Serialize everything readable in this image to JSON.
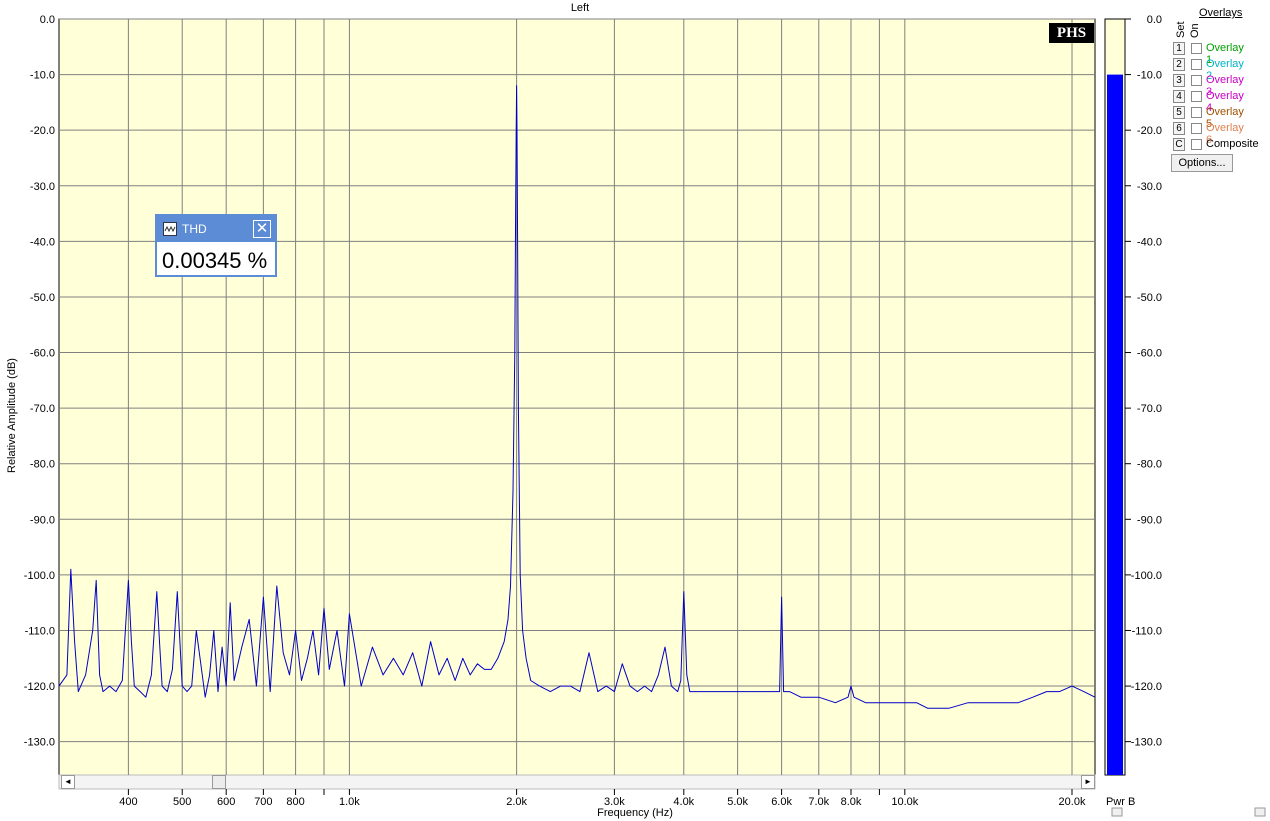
{
  "chart_data": {
    "type": "line",
    "title": "Left",
    "xlabel": "Frequency (Hz)",
    "ylabel": "Relative Amplitude (dB)",
    "xscale": "log",
    "xlim": [
      300,
      22000
    ],
    "ylim": [
      -136,
      0
    ],
    "grid": true,
    "yticks": [
      {
        "v": 0,
        "l": "0.0"
      },
      {
        "v": -10,
        "l": "-10.0"
      },
      {
        "v": -20,
        "l": "-20.0"
      },
      {
        "v": -30,
        "l": "-30.0"
      },
      {
        "v": -40,
        "l": "-40.0"
      },
      {
        "v": -50,
        "l": "-50.0"
      },
      {
        "v": -60,
        "l": "-60.0"
      },
      {
        "v": -70,
        "l": "-70.0"
      },
      {
        "v": -80,
        "l": "-80.0"
      },
      {
        "v": -90,
        "l": "-90.0"
      },
      {
        "v": -100,
        "l": "-100.0"
      },
      {
        "v": -110,
        "l": "-110.0"
      },
      {
        "v": -120,
        "l": "-120.0"
      },
      {
        "v": -130,
        "l": "-130.0"
      }
    ],
    "xticks": [
      {
        "v": 400,
        "l": "400"
      },
      {
        "v": 500,
        "l": "500"
      },
      {
        "v": 600,
        "l": "600"
      },
      {
        "v": 700,
        "l": "700"
      },
      {
        "v": 800,
        "l": "800"
      },
      {
        "v": 1000,
        "l": "1.0k"
      },
      {
        "v": 2000,
        "l": "2.0k"
      },
      {
        "v": 3000,
        "l": "3.0k"
      },
      {
        "v": 4000,
        "l": "4.0k"
      },
      {
        "v": 5000,
        "l": "5.0k"
      },
      {
        "v": 6000,
        "l": "6.0k"
      },
      {
        "v": 7000,
        "l": "7.0k"
      },
      {
        "v": 8000,
        "l": "8.0k"
      },
      {
        "v": 10000,
        "l": "10.0k"
      },
      {
        "v": 20000,
        "l": "20.0k"
      }
    ],
    "gridx": [
      400,
      500,
      600,
      700,
      800,
      900,
      1000,
      2000,
      3000,
      4000,
      5000,
      6000,
      7000,
      8000,
      9000,
      10000,
      20000
    ],
    "series": [
      {
        "color": "#0000c8",
        "x": [
          300,
          310,
          315,
          320,
          325,
          335,
          345,
          350,
          355,
          360,
          370,
          380,
          390,
          400,
          405,
          410,
          420,
          430,
          440,
          450,
          455,
          460,
          470,
          480,
          490,
          500,
          510,
          520,
          530,
          540,
          550,
          560,
          570,
          580,
          590,
          600,
          610,
          620,
          640,
          660,
          680,
          700,
          720,
          740,
          760,
          780,
          800,
          820,
          840,
          860,
          880,
          900,
          920,
          950,
          980,
          1000,
          1050,
          1100,
          1150,
          1200,
          1250,
          1300,
          1350,
          1400,
          1450,
          1500,
          1550,
          1600,
          1650,
          1700,
          1750,
          1800,
          1850,
          1900,
          1930,
          1950,
          1970,
          1985,
          1992,
          1997,
          2000,
          2003,
          2008,
          2015,
          2030,
          2050,
          2080,
          2120,
          2200,
          2300,
          2400,
          2500,
          2600,
          2700,
          2800,
          2900,
          3000,
          3100,
          3200,
          3300,
          3400,
          3500,
          3600,
          3700,
          3800,
          3900,
          3950,
          4000,
          4050,
          4100,
          4300,
          4500,
          4800,
          5000,
          5200,
          5500,
          5800,
          5950,
          6000,
          6050,
          6200,
          6500,
          7000,
          7500,
          7900,
          8000,
          8100,
          8500,
          9000,
          9500,
          10000,
          10500,
          11000,
          12000,
          13000,
          14000,
          15000,
          16000,
          17000,
          18000,
          19000,
          20000,
          21000,
          22000
        ],
        "y": [
          -120,
          -118,
          -99,
          -112,
          -121,
          -118,
          -110,
          -101,
          -118,
          -121,
          -120,
          -121,
          -119,
          -101,
          -112,
          -120,
          -121,
          -122,
          -118,
          -103,
          -112,
          -120,
          -121,
          -117,
          -103,
          -120,
          -121,
          -120,
          -110,
          -116,
          -122,
          -118,
          -110,
          -121,
          -113,
          -120,
          -105,
          -119,
          -113,
          -108,
          -120,
          -104,
          -121,
          -102,
          -114,
          -118,
          -110,
          -119,
          -115,
          -110,
          -118,
          -106,
          -117,
          -110,
          -120,
          -107,
          -120,
          -113,
          -118,
          -115,
          -118,
          -114,
          -120,
          -112,
          -118,
          -115,
          -119,
          -115,
          -118,
          -116,
          -117,
          -117,
          -115,
          -112,
          -108,
          -102,
          -85,
          -60,
          -35,
          -20,
          -12,
          -20,
          -40,
          -70,
          -100,
          -110,
          -115,
          -119,
          -120,
          -121,
          -120,
          -120,
          -121,
          -114,
          -121,
          -120,
          -121,
          -116,
          -120,
          -121,
          -120,
          -121,
          -118,
          -113,
          -120,
          -121,
          -119,
          -103,
          -118,
          -121,
          -121,
          -121,
          -121,
          -121,
          -121,
          -121,
          -121,
          -121,
          -104,
          -121,
          -121,
          -122,
          -122,
          -123,
          -122,
          -120,
          -122,
          -123,
          -123,
          -123,
          -123,
          -123,
          -124,
          -124,
          -123,
          -123,
          -123,
          -123,
          -122,
          -121,
          -121,
          -120,
          -121,
          -122
        ]
      }
    ]
  },
  "thd_box": {
    "title": "THD",
    "value": "0.00345 %",
    "close_glyph": "✕"
  },
  "logo": "PHS",
  "meter": {
    "label": "Pwr B",
    "level_db": -10,
    "ticks": [
      "0.0",
      "-10.0",
      "-20.0",
      "-30.0",
      "-40.0",
      "-50.0",
      "-60.0",
      "-70.0",
      "-80.0",
      "-90.0",
      "-100.0",
      "-110.0",
      "-120.0",
      "-130.0"
    ]
  },
  "overlays": {
    "title": "Overlays",
    "set_label": "Set",
    "on_label": "On",
    "items": [
      {
        "num": "1",
        "label": "Overlay 1",
        "color": "#00a000"
      },
      {
        "num": "2",
        "label": "Overlay 2",
        "color": "#00b4c8"
      },
      {
        "num": "3",
        "label": "Overlay 3",
        "color": "#c800c8"
      },
      {
        "num": "4",
        "label": "Overlay 4",
        "color": "#c800c8"
      },
      {
        "num": "5",
        "label": "Overlay 5",
        "color": "#a05000"
      },
      {
        "num": "6",
        "label": "Overlay 6",
        "color": "#e08050"
      },
      {
        "num": "C",
        "label": "Composite",
        "color": "#000000"
      }
    ],
    "options_label": "Options..."
  },
  "scrollbar": {
    "left_glyph": "◄",
    "right_glyph": "►"
  },
  "colors": {
    "plot_bg": "#ffffd8",
    "grid": "#808080",
    "trace": "#0000c8",
    "meter_fill": "#0000ff"
  }
}
